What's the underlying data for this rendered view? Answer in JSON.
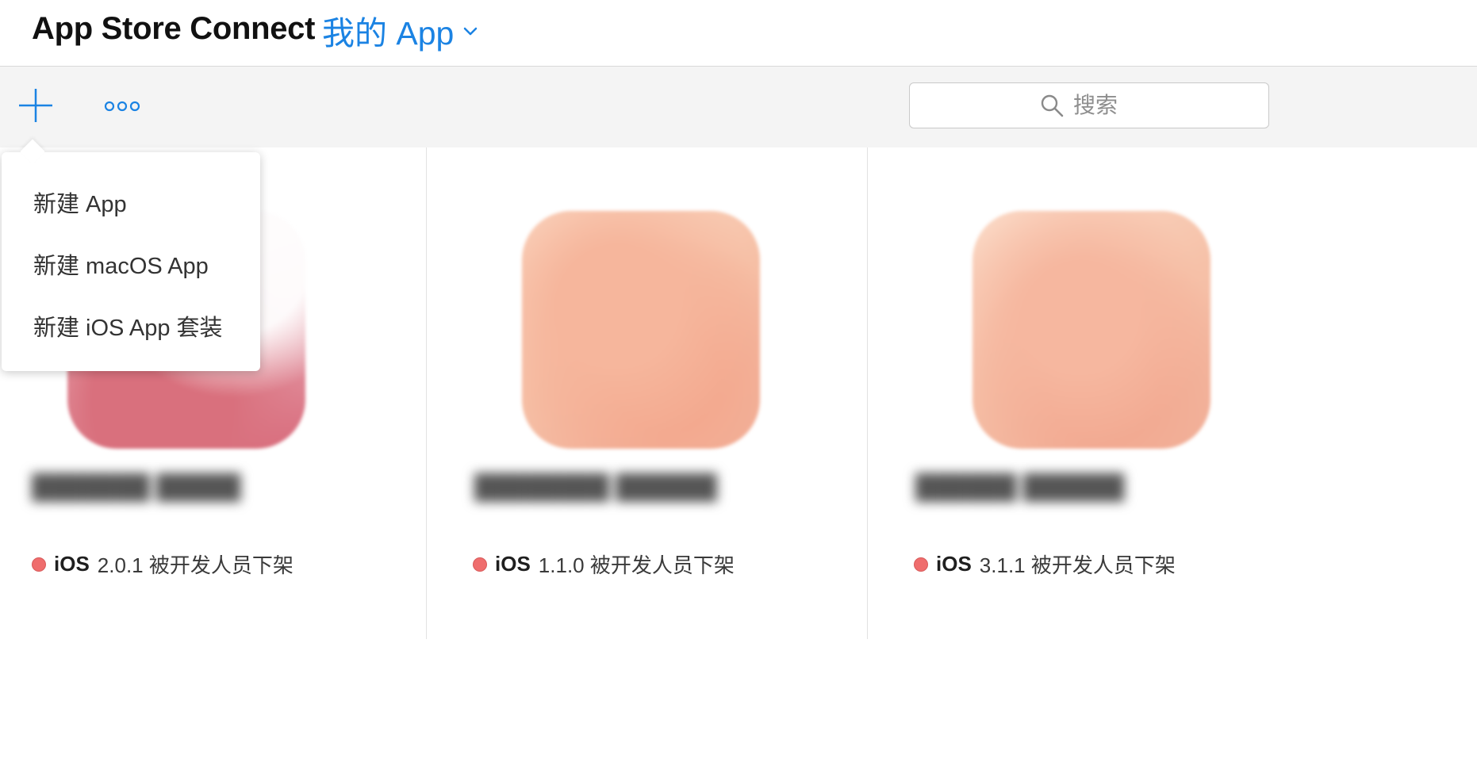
{
  "header": {
    "title": "App Store Connect",
    "section": "我的 App"
  },
  "toolbar": {
    "add_icon": "plus-icon",
    "more_icon": "ellipsis-icon",
    "search_placeholder": "搜索"
  },
  "dropdown": {
    "items": [
      {
        "label": "新建 App"
      },
      {
        "label": "新建 macOS App"
      },
      {
        "label": "新建 iOS App 套装"
      }
    ]
  },
  "apps": [
    {
      "name": "███████ █████",
      "platform": "iOS",
      "status": "2.0.1 被开发人员下架"
    },
    {
      "name": "████████ ██████",
      "platform": "iOS",
      "status": "1.1.0 被开发人员下架"
    },
    {
      "name": "██████ ██████",
      "platform": "iOS",
      "status": "3.1.1 被开发人员下架"
    }
  ],
  "colors": {
    "accent": "#1b83e3",
    "status_removed": "#ef6d6d",
    "toolbar_bg": "#f4f4f4"
  }
}
